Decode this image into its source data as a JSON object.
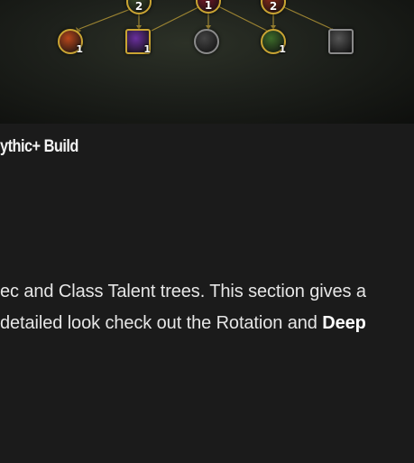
{
  "talent_tree": {
    "nodes": [
      {
        "name": "fire-claw-talent-icon",
        "shape": "circle",
        "color": "#b8471c",
        "badge": "1"
      },
      {
        "name": "arcane-purple-talent-icon",
        "shape": "square",
        "color": "#6a2f9e",
        "badge": "1"
      },
      {
        "name": "gray-rune-talent-icon",
        "shape": "circle",
        "color": "#444444",
        "badge": ""
      },
      {
        "name": "green-beast-talent-icon",
        "shape": "circle",
        "color": "#3c6b2a",
        "badge": "1"
      },
      {
        "name": "white-claw-talent-icon",
        "shape": "square",
        "color": "#555555",
        "badge": ""
      }
    ],
    "top_nodes": [
      {
        "name": "top-talent-1-icon",
        "label": "2",
        "color": "#3a4a2a"
      },
      {
        "name": "top-talent-2-icon",
        "label": "1",
        "color": "#7a1a2a"
      },
      {
        "name": "top-talent-3-icon",
        "label": "2",
        "color": "#8a2a1a"
      }
    ]
  },
  "section": {
    "build_title": "ythic+ Build",
    "line1": "ec and Class Talent trees. This section gives a",
    "line2_prefix": "detailed look check out the Rotation and ",
    "line2_bold": "Deep"
  }
}
